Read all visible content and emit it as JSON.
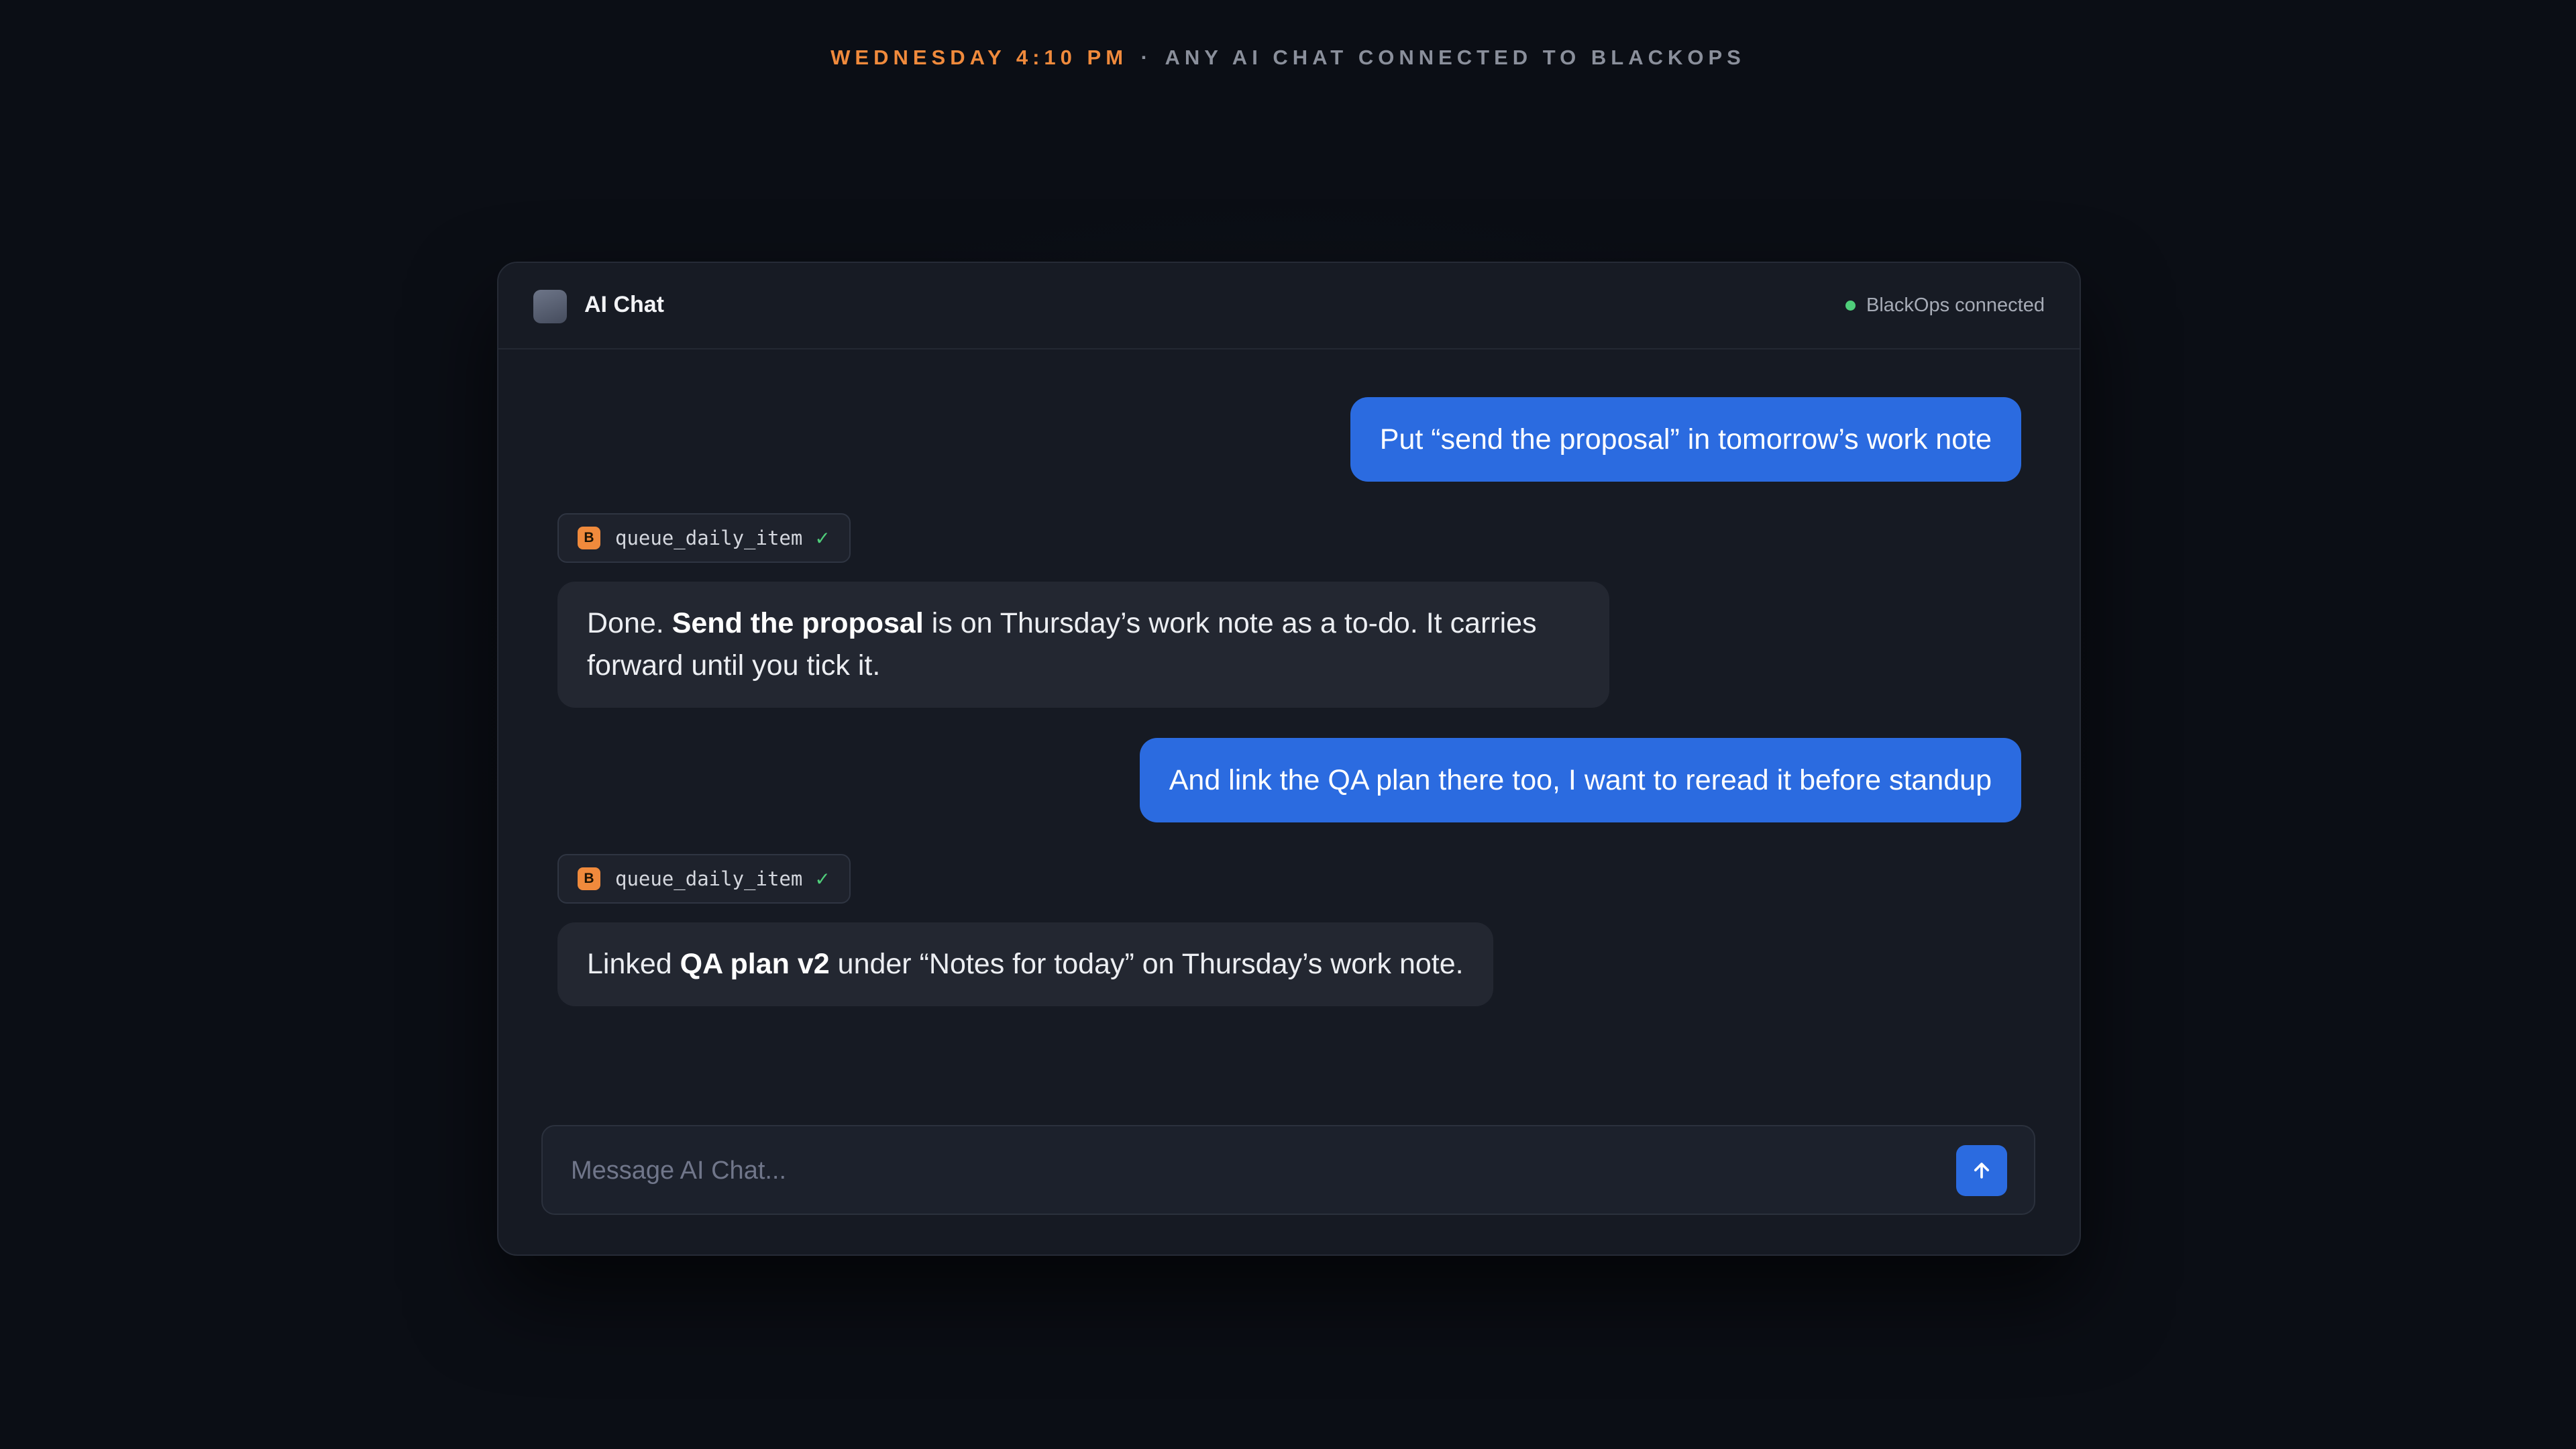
{
  "caption": {
    "time": "WEDNESDAY 4:10 PM",
    "separator": "·",
    "description": "ANY AI CHAT CONNECTED TO BLACKOPS"
  },
  "window": {
    "title": "AI Chat",
    "status": "BlackOps connected",
    "status_color": "#4fce7a",
    "icon": "app-icon"
  },
  "conversation": {
    "user_1": "Put “send the proposal” in tomorrow’s work note",
    "tool_1": {
      "icon_letter": "B",
      "name": "queue_daily_item",
      "check": "✓"
    },
    "ai_1": {
      "prefix": "Done. ",
      "bold": "Send the proposal",
      "suffix": " is on Thursday’s work note as a to-do. It carries forward until you tick it."
    },
    "user_2": "And link the QA plan there too, I want to reread it before standup",
    "tool_2": {
      "icon_letter": "B",
      "name": "queue_daily_item",
      "check": "✓"
    },
    "ai_2": {
      "prefix": "Linked ",
      "bold": "QA plan v2",
      "suffix": " under “Notes for today” on Thursday’s work note."
    }
  },
  "composer": {
    "placeholder": "Message AI Chat...",
    "send_icon": "arrow-up-icon"
  },
  "colors": {
    "accent": "#f08a3c",
    "user_bubble": "#2b6be0",
    "ai_bubble": "#232731",
    "background": "#0b0e15"
  }
}
